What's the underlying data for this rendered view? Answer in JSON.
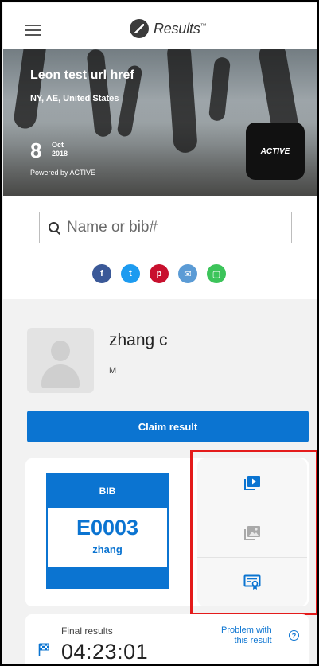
{
  "header": {
    "logo_text": "Results",
    "logo_tm": "™"
  },
  "event": {
    "title": "Leon test url href",
    "location": "NY, AE, United States",
    "date_day": "8",
    "date_month": "Oct",
    "date_year": "2018",
    "powered_by": "Powered by ACTIVE",
    "badge_text": "ACTIVE"
  },
  "search": {
    "placeholder": "Name or bib#"
  },
  "share": [
    {
      "label": "f",
      "icon": "facebook-icon",
      "color": "#3b5998"
    },
    {
      "label": "t",
      "icon": "twitter-icon",
      "color": "#1d9bf0"
    },
    {
      "label": "p",
      "icon": "pinterest-icon",
      "color": "#c8102e"
    },
    {
      "label": "✉",
      "icon": "email-icon",
      "color": "#5b9bd5"
    },
    {
      "label": "▢",
      "icon": "message-icon",
      "color": "#3cc45a"
    }
  ],
  "athlete": {
    "name": "zhang c",
    "gender": "M",
    "claim_label": "Claim result"
  },
  "bib": {
    "header": "BIB",
    "number": "E0003",
    "name": "zhang"
  },
  "actions": [
    {
      "icon": "video-icon"
    },
    {
      "icon": "photo-icon"
    },
    {
      "icon": "certificate-icon"
    }
  ],
  "final": {
    "label": "Final results",
    "time": "04:23:01",
    "problem_line1": "Problem with",
    "problem_line2": "this result",
    "help": "?"
  },
  "colors": {
    "accent": "#0b74d1",
    "highlight": "#e41b1b"
  }
}
